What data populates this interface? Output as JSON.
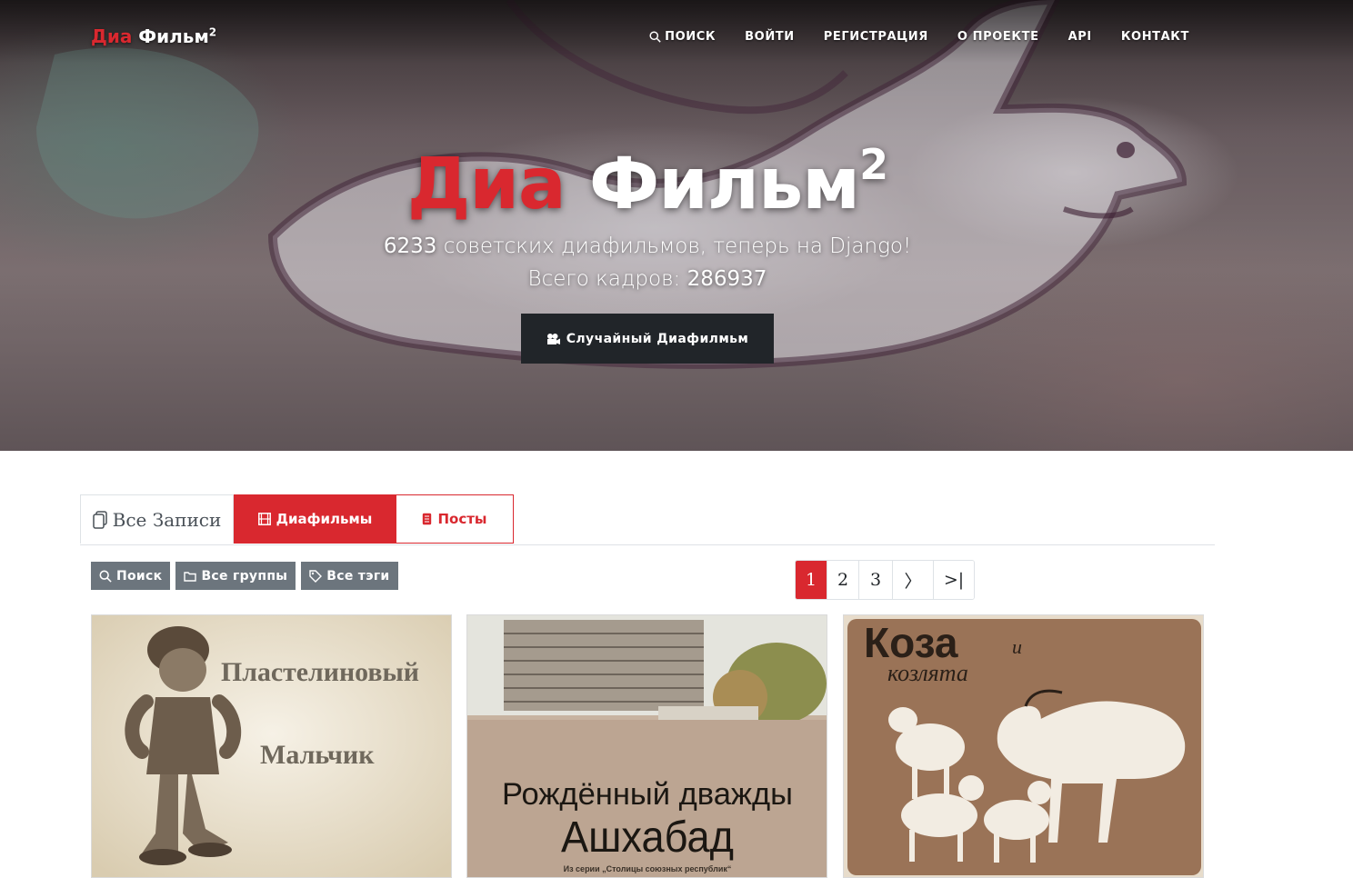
{
  "brand": {
    "part1": "Диа",
    "part2": "Фильм",
    "sup": "2"
  },
  "nav": {
    "search": "ПОИСК",
    "login": "ВОЙТИ",
    "register": "РЕГИСТРАЦИЯ",
    "about": "О ПРОЕКТЕ",
    "api": "API",
    "contact": "КОНТАКТ"
  },
  "hero": {
    "title_part1": "Диа",
    "title_part2": "Фильм",
    "title_sup": "2",
    "film_count": "6233",
    "subtitle_text": "советских диафильмов, теперь на Django!",
    "frames_label": "Всего кадров:",
    "frames_count": "286937",
    "random_button": "Случайный Диафилмьм"
  },
  "tabs": {
    "all": "Все Записи",
    "films": "Диафильмы",
    "posts": "Посты"
  },
  "filters": {
    "search": "Поиск",
    "groups": "Все группы",
    "tags": "Все тэги"
  },
  "pagination": {
    "pages": [
      "1",
      "2",
      "3"
    ],
    "current": "1",
    "next": "〉",
    "last": ">|"
  },
  "cards": [
    {
      "title_line1": "Пластелиновый",
      "title_line2": "Мальчик"
    },
    {
      "title_line1": "Рождённый дважды",
      "title_line2": "Ашхабад",
      "series": "Из серии „Столицы союзных республик“"
    },
    {
      "title_line1": "Коза",
      "title_and": "и",
      "title_line2": "козлята"
    }
  ],
  "colors": {
    "accent": "#d9282f",
    "dark": "#212529",
    "muted": "#6c757d"
  },
  "icons": {
    "nav_search": "search-icon",
    "random": "film-camera-icon",
    "all": "copy-icon",
    "films": "film-icon",
    "posts": "document-icon",
    "filter_search": "search-icon",
    "filter_groups": "folder-icon",
    "filter_tags": "tag-icon"
  }
}
